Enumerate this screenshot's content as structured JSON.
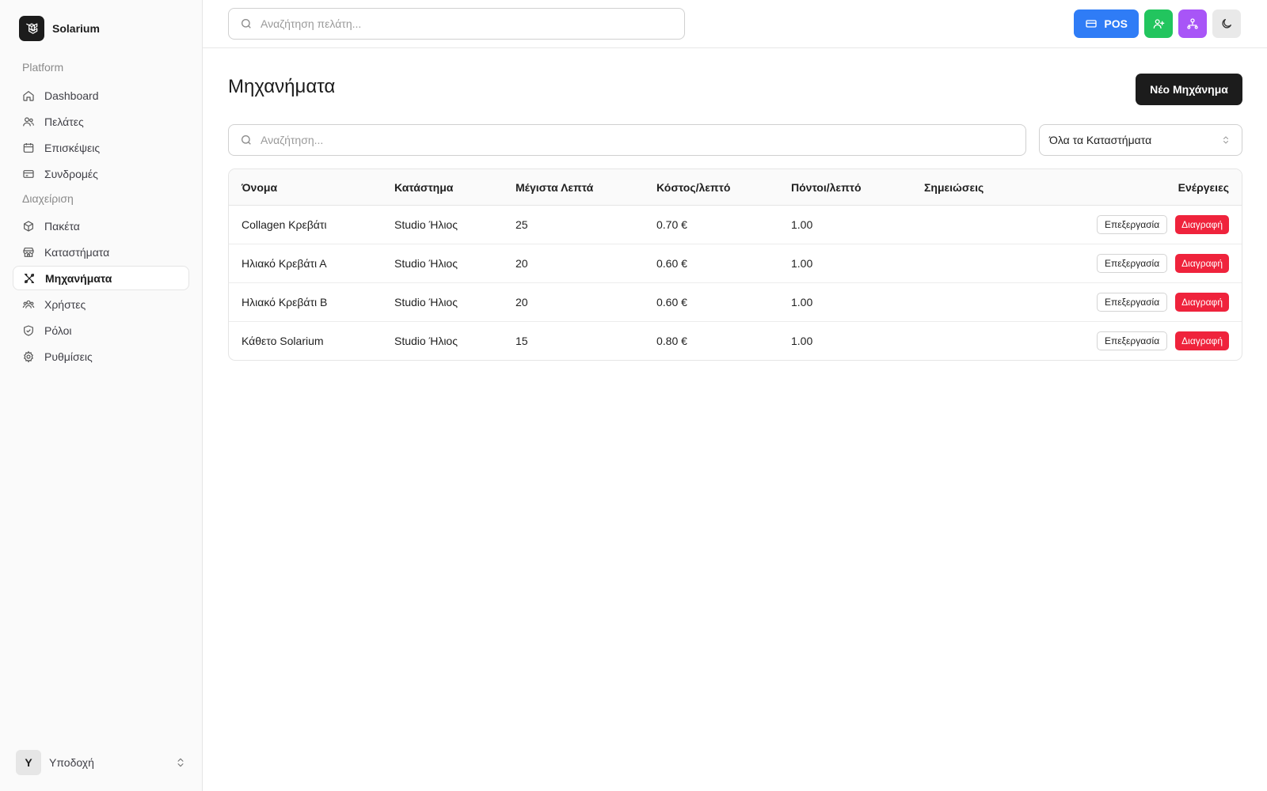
{
  "app": {
    "name": "Solarium"
  },
  "sidebar": {
    "groups": [
      {
        "label": "Platform"
      },
      {
        "label": "Διαχείριση"
      }
    ],
    "items": [
      {
        "label": "Dashboard",
        "icon": "home-icon"
      },
      {
        "label": "Πελάτες",
        "icon": "users-icon"
      },
      {
        "label": "Επισκέψεις",
        "icon": "calendar-icon"
      },
      {
        "label": "Συνδρομές",
        "icon": "credit-card-icon"
      },
      {
        "label": "Πακέτα",
        "icon": "package-icon"
      },
      {
        "label": "Καταστήματα",
        "icon": "store-icon"
      },
      {
        "label": "Μηχανήματα",
        "icon": "tools-icon",
        "active": true
      },
      {
        "label": "Χρήστες",
        "icon": "user-group-icon"
      },
      {
        "label": "Ρόλοι",
        "icon": "shield-icon"
      },
      {
        "label": "Ρυθμίσεις",
        "icon": "gear-icon"
      }
    ],
    "user": {
      "initial": "Y",
      "name": "Υποδοχή"
    }
  },
  "topbar": {
    "search_placeholder": "Αναζήτηση πελάτη...",
    "pos_label": "POS"
  },
  "main": {
    "title": "Μηχανήματα",
    "new_button": "Νέο Μηχάνημα",
    "search_placeholder": "Αναζήτηση...",
    "store_filter": "Όλα τα Καταστήματα"
  },
  "table": {
    "headers": [
      "Όνομα",
      "Κατάστημα",
      "Μέγιστα Λεπτά",
      "Κόστος/λεπτό",
      "Πόντοι/λεπτό",
      "Σημειώσεις",
      "Ενέργειες"
    ],
    "edit_label": "Επεξεργασία",
    "delete_label": "Διαγραφή",
    "rows": [
      {
        "name": "Collagen Κρεβάτι",
        "store": "Studio Ήλιος",
        "max_minutes": "25",
        "cost": "0.70 €",
        "points": "1.00",
        "notes": ""
      },
      {
        "name": "Ηλιακό Κρεβάτι Α",
        "store": "Studio Ήλιος",
        "max_minutes": "20",
        "cost": "0.60 €",
        "points": "1.00",
        "notes": ""
      },
      {
        "name": "Ηλιακό Κρεβάτι Β",
        "store": "Studio Ήλιος",
        "max_minutes": "20",
        "cost": "0.60 €",
        "points": "1.00",
        "notes": ""
      },
      {
        "name": "Κάθετο Solarium",
        "store": "Studio Ήλιος",
        "max_minutes": "15",
        "cost": "0.80 €",
        "points": "1.00",
        "notes": ""
      }
    ]
  },
  "colors": {
    "pos_blue": "#2f7cf6",
    "green": "#22c55e",
    "purple": "#a855f7",
    "danger": "#ef233c",
    "dark": "#1c1c1c"
  }
}
